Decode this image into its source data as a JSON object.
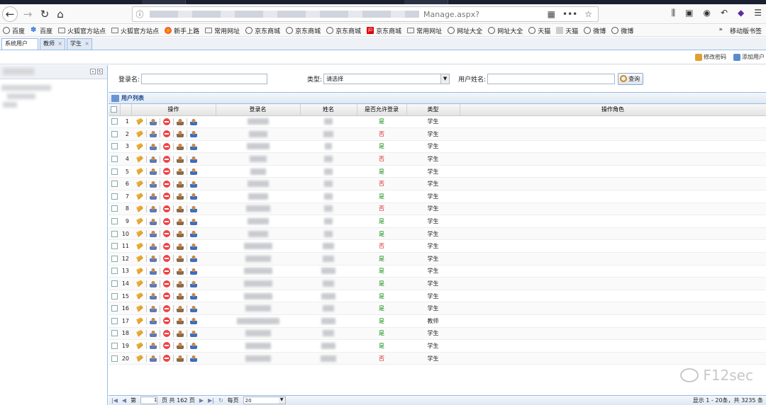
{
  "browser": {
    "url_tail": "Manage.aspx?",
    "bookmarks": [
      {
        "icon": "globe-icon",
        "label": "百度",
        "style": ""
      },
      {
        "icon": "paw-icon",
        "label": "百度",
        "style": "paw"
      },
      {
        "icon": "folder-icon",
        "label": "火狐官方站点",
        "style": "folder"
      },
      {
        "icon": "folder-icon",
        "label": "火狐官方站点",
        "style": "folder"
      },
      {
        "icon": "firefox-icon",
        "label": "新手上路",
        "style": "ff"
      },
      {
        "icon": "folder-icon",
        "label": "常用网址",
        "style": "folder"
      },
      {
        "icon": "globe-icon",
        "label": "京东商城",
        "style": ""
      },
      {
        "icon": "globe-icon",
        "label": "京东商城",
        "style": ""
      },
      {
        "icon": "globe-icon",
        "label": "京东商城",
        "style": ""
      },
      {
        "icon": "jd-icon",
        "label": "京东商城",
        "style": "jd"
      },
      {
        "icon": "folder-icon",
        "label": "常用网址",
        "style": "folder"
      },
      {
        "icon": "globe-icon",
        "label": "网址大全",
        "style": ""
      },
      {
        "icon": "globe-icon",
        "label": "网址大全",
        "style": ""
      },
      {
        "icon": "globe-icon",
        "label": "天猫",
        "style": ""
      },
      {
        "icon": "tmall-icon",
        "label": "天猫",
        "style": "tm"
      },
      {
        "icon": "globe-icon",
        "label": "微博",
        "style": ""
      },
      {
        "icon": "globe-icon",
        "label": "微博",
        "style": ""
      }
    ],
    "overflow": "»",
    "mobile_bookmarks": "移动版书签"
  },
  "tabs": [
    {
      "label": "系统用户",
      "active": true
    },
    {
      "label": "教师",
      "active": false
    },
    {
      "label": "学生",
      "active": false
    }
  ],
  "header_links": {
    "change_password": "修改密码",
    "add_user": "添加用户"
  },
  "search": {
    "login_label": "登录名:",
    "type_label": "类型:",
    "type_value": "请选择",
    "name_label": "用户姓名:",
    "button": "查询"
  },
  "grid": {
    "title": "用户列表",
    "columns": [
      "操作",
      "登录名",
      "姓名",
      "是否允许登录",
      "类型",
      "操作角色"
    ],
    "rows": [
      {
        "n": "1",
        "allow": "是",
        "type": "学生"
      },
      {
        "n": "2",
        "allow": "否",
        "type": "学生"
      },
      {
        "n": "3",
        "allow": "是",
        "type": "学生"
      },
      {
        "n": "4",
        "allow": "否",
        "type": "学生"
      },
      {
        "n": "5",
        "allow": "是",
        "type": "学生"
      },
      {
        "n": "6",
        "allow": "否",
        "type": "学生"
      },
      {
        "n": "7",
        "allow": "是",
        "type": "学生"
      },
      {
        "n": "8",
        "allow": "否",
        "type": "学生"
      },
      {
        "n": "9",
        "allow": "是",
        "type": "学生"
      },
      {
        "n": "10",
        "allow": "是",
        "type": "学生"
      },
      {
        "n": "11",
        "allow": "否",
        "type": "学生"
      },
      {
        "n": "12",
        "allow": "是",
        "type": "学生"
      },
      {
        "n": "13",
        "allow": "是",
        "type": "学生"
      },
      {
        "n": "14",
        "allow": "是",
        "type": "学生"
      },
      {
        "n": "15",
        "allow": "是",
        "type": "学生"
      },
      {
        "n": "16",
        "allow": "是",
        "type": "学生"
      },
      {
        "n": "17",
        "allow": "是",
        "type": "教师"
      },
      {
        "n": "18",
        "allow": "是",
        "type": "学生"
      },
      {
        "n": "19",
        "allow": "是",
        "type": "学生"
      },
      {
        "n": "20",
        "allow": "否",
        "type": "学生"
      }
    ]
  },
  "pager": {
    "page_prefix": "第",
    "page": "1",
    "page_suffix": "页 共 162 页",
    "per_page_label": "每页",
    "page_size": "20",
    "info": "显示 1 - 20条，共 3235 条"
  },
  "watermark": "F12sec",
  "colors": {
    "yes": "#0a8a0a",
    "no": "#d62020",
    "border": "#99bbe8",
    "title": "#15428b"
  }
}
